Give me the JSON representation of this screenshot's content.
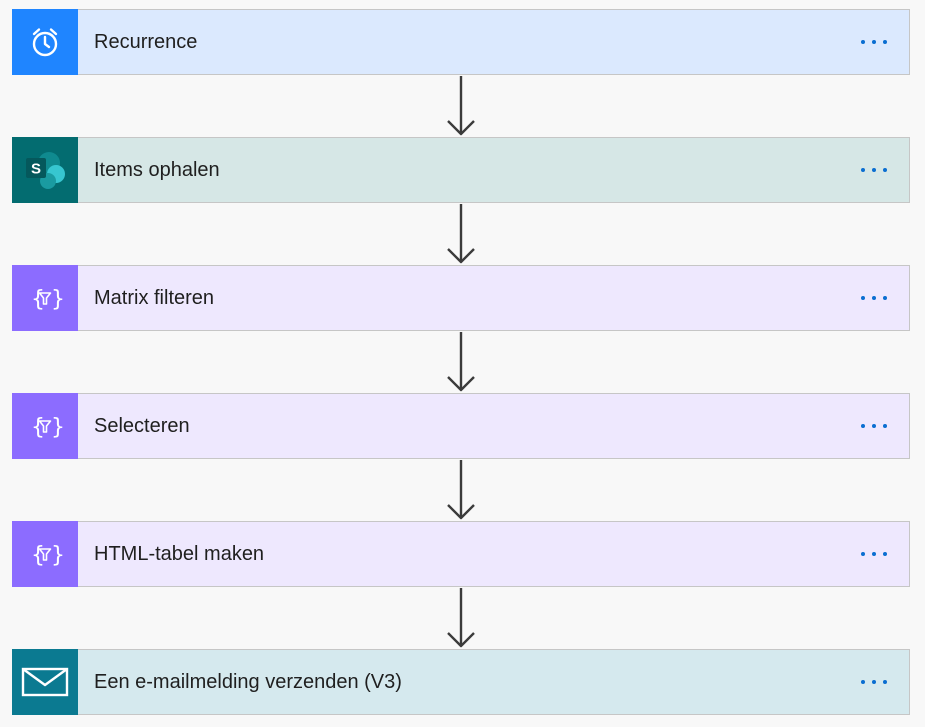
{
  "steps": [
    {
      "title": "Recurrence",
      "icon": "alarm-clock-icon",
      "icon_bg": "#1f85ff",
      "card_bg": "#dbe9fe"
    },
    {
      "title": "Items ophalen",
      "icon": "sharepoint-icon",
      "icon_bg": "#036c70",
      "card_bg": "#d6e7e6"
    },
    {
      "title": "Matrix filteren",
      "icon": "data-operation-icon",
      "icon_bg": "#8c6cff",
      "card_bg": "#eee8fe"
    },
    {
      "title": "Selecteren",
      "icon": "data-operation-icon",
      "icon_bg": "#8c6cff",
      "card_bg": "#eee8fe"
    },
    {
      "title": "HTML-tabel maken",
      "icon": "data-operation-icon",
      "icon_bg": "#8c6cff",
      "card_bg": "#eee8fe"
    },
    {
      "title": "Een e-mailmelding verzenden (V3)",
      "icon": "mail-icon",
      "icon_bg": "#0b7a91",
      "card_bg": "#d5e9ee"
    }
  ],
  "more_menu_icon": "more-dots-icon",
  "connector_icon": "down-arrow-icon"
}
